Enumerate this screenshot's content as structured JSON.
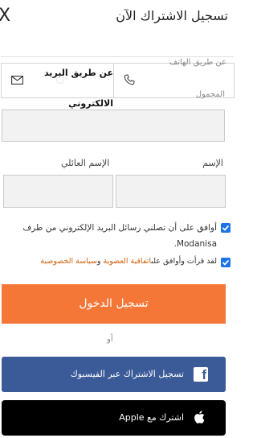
{
  "header": {
    "title": "تسجيل الاشتراك الآن",
    "close_symbol": "X"
  },
  "method": {
    "email_label": "عن طريق البريد الالكتروني",
    "phone_label": "عن طريق الهاتف",
    "mobile_label": "المحمول",
    "email_icon": "envelope-icon",
    "phone_icon": "phone-icon",
    "selected": "email"
  },
  "form": {
    "main_input_value": "",
    "first_name_label": "الإسم",
    "last_name_label": "الإسم العائلي",
    "first_name_value": "",
    "last_name_value": ""
  },
  "consent": {
    "newsletter_text": "أوافق على أن تصلني رسائل البريد الإلكتروني من طرف Modanisa.",
    "terms_prefix": "لقد قرأت وأوافق على",
    "terms_link": "اتفاقية العضوية",
    "terms_and": " و",
    "privacy_link": "سياسة الخصوصية",
    "newsletter_checked": true,
    "terms_checked": true
  },
  "actions": {
    "login_label": "تسجيل الدخول",
    "or_label": "أو",
    "facebook_label": "تسجيل الاشتراك عبر الفيسبوك",
    "apple_label": "اشترك مع Apple"
  },
  "colors": {
    "primary_button": "#f47738",
    "facebook": "#3b5a98",
    "apple": "#000000",
    "link": "#d4620f",
    "checkbox": "#1a73e8"
  }
}
